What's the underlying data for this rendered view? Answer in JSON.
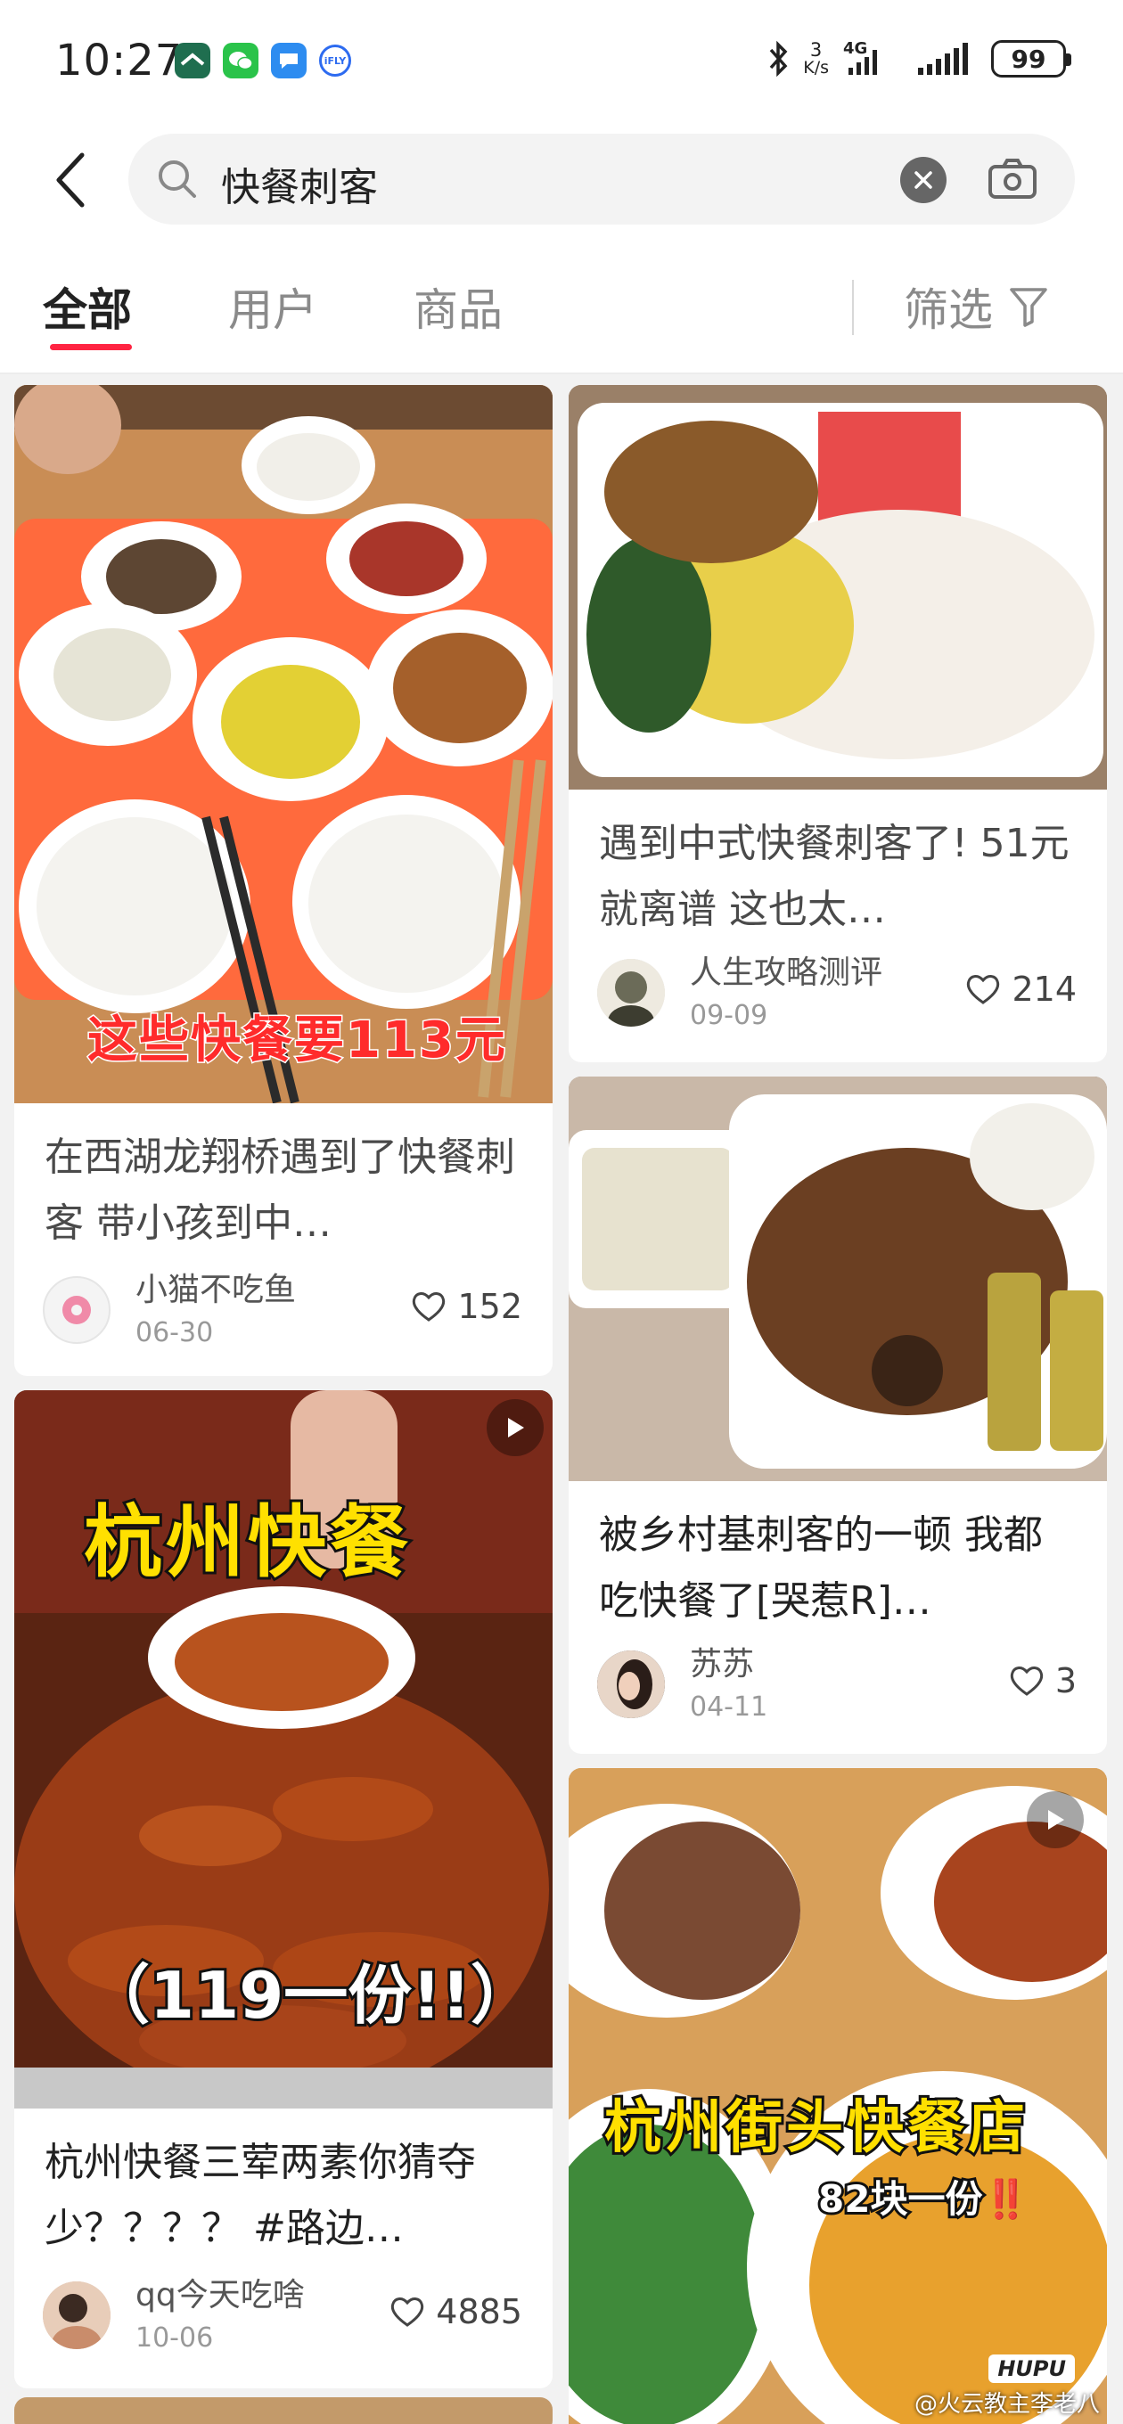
{
  "status_bar": {
    "time": "10:27",
    "net_speed_value": "3",
    "net_speed_unit": "K/s",
    "network": "4G",
    "battery": "99",
    "icons": [
      "app-green-icon",
      "wechat-icon",
      "message-icon",
      "ifly-icon",
      "bluetooth-icon",
      "signal-icon",
      "wifi-icon"
    ]
  },
  "search": {
    "query": "快餐刺客",
    "icons": [
      "back-arrow-icon",
      "search-icon",
      "clear-icon",
      "camera-icon"
    ]
  },
  "tabs": {
    "items": [
      {
        "label": "全部",
        "active": true
      },
      {
        "label": "用户",
        "active": false
      },
      {
        "label": "商品",
        "active": false
      }
    ],
    "filter_label": "筛选",
    "accent": "#ff2442"
  },
  "feed": {
    "left": [
      {
        "overlay": "这些快餐要113元",
        "title": "在西湖龙翔桥遇到了快餐刺客 带小孩到中…",
        "author": "小猫不吃鱼",
        "date": "06-30",
        "likes": "152"
      },
      {
        "overlay_top": "杭州快餐",
        "overlay_bottom": "（119一份!!）",
        "title": "杭州快餐三荤两素你猜夺少？？？？ #路边…",
        "author": "qq今天吃啥",
        "date": "10-06",
        "likes": "4885"
      }
    ],
    "right": [
      {
        "title": "遇到中式快餐刺客了! 51元就离谱 这也太…",
        "author": "人生攻略测评",
        "date": "09-09",
        "likes": "214"
      },
      {
        "title": "被乡村基刺客的一顿 我都吃快餐了[哭惹R]…",
        "author": "苏苏",
        "date": "04-11",
        "likes": "3"
      },
      {
        "overlay_top": "杭州街头快餐店",
        "overlay_sub": "82块一份‼️",
        "badge": "HUPU",
        "watermark": "@火云教主李老八"
      }
    ]
  }
}
